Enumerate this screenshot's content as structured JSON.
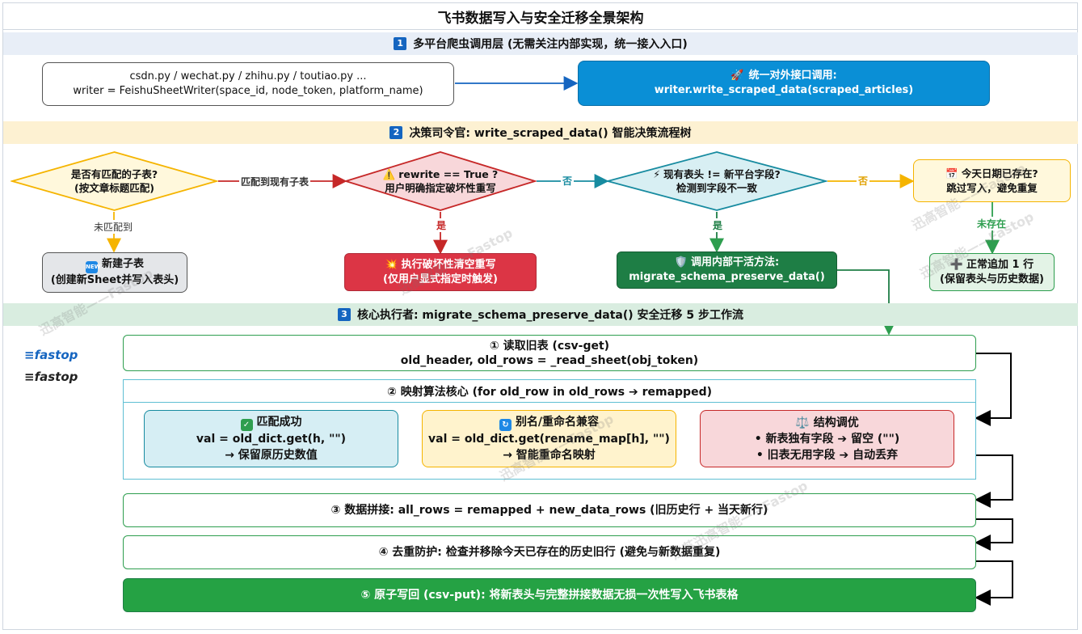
{
  "title": "飞书数据写入与安全迁移全景架构",
  "layer1": {
    "num": "1",
    "title": "多平台爬虫调用层 (无需关注内部实现，统一接入入口)",
    "scripts_line1": "csdn.py / wechat.py / zhihu.py / toutiao.py ...",
    "scripts_line2": "writer = FeishuSheetWriter(space_id, node_token, platform_name)",
    "api_line1": "统一对外接口调用:",
    "api_line2": "writer.write_scraped_data(scraped_articles)",
    "api_icon": "rocket-icon"
  },
  "layer2": {
    "num": "2",
    "title": "决策司令官: write_scraped_data() 智能决策流程树",
    "d1_line1": "是否有匹配的子表?",
    "d1_line2": "(按文章标题匹配)",
    "d1_no": "未匹配到",
    "d1_yes": "匹配到现有子表",
    "d2_line1": "rewrite == True ?",
    "d2_line2": "用户明确指定破坏性重写",
    "d2_icon": "warning-icon",
    "d2_yes": "是",
    "d2_no": "否",
    "d3_line1": "现有表头 != 新平台字段?",
    "d3_line2": "检测到字段不一致",
    "d3_icon": "lightning-icon",
    "d3_yes": "是",
    "d3_no": "否",
    "d4_line1": "今天日期已存在?",
    "d4_line2": "跳过写入，避免重复",
    "d4_icon": "calendar-icon",
    "d4_no": "未存在",
    "r1_line1": "新建子表",
    "r1_line2": "(创建新Sheet并写入表头)",
    "r1_icon": "new-icon",
    "r2_line1": "执行破坏性清空重写",
    "r2_line2": "(仅用户显式指定时触发)",
    "r2_icon": "explosion-icon",
    "r3_line1": "调用内部干活方法:",
    "r3_line2": "migrate_schema_preserve_data()",
    "r3_icon": "shield-icon",
    "r4_line1": "正常追加 1 行",
    "r4_line2": "(保留表头与历史数据)",
    "r4_icon": "plus-icon"
  },
  "layer3": {
    "num": "3",
    "title": "核心执行者: migrate_schema_preserve_data() 安全迁移 5 步工作流",
    "s1_line1": "① 读取旧表 (csv-get)",
    "s1_line2": "old_header, old_rows = _read_sheet(obj_token)",
    "s2_title": "② 映射算法核心 (for old_row in old_rows ➔ remapped)",
    "c1_title": "匹配成功",
    "c1_icon": "check-icon",
    "c1_line1": "val = old_dict.get(h, \"\")",
    "c1_line2": "→ 保留原历史数值",
    "c2_title": "别名/重命名兼容",
    "c2_icon": "refresh-icon",
    "c2_line1": "val = old_dict.get(rename_map[h], \"\")",
    "c2_line2": "→ 智能重命名映射",
    "c3_title": "结构调优",
    "c3_icon": "scales-icon",
    "c3_line1": "• 新表独有字段 ➔ 留空 (\"\")",
    "c3_line2": "• 旧表无用字段 ➔ 自动丢弃",
    "s3": "③ 数据拼接: all_rows = remapped + new_data_rows (旧历史行 + 当天新行)",
    "s4": "④ 去重防护: 检查并移除今天已存在的历史旧行 (避免与新数据重复)",
    "s5": "⑤ 原子写回 (csv-put): 将新表头与完整拼接数据无损一次性写入飞书表格"
  },
  "logos": [
    "fastop",
    "fastop"
  ],
  "watermarks": [
    "迅高智能——Fastop",
    "迅高智能——Fastop",
    "迅高智能——Fastop",
    "迅高智能——Fastop",
    "江苏迅高智能——Fastop",
    "迅高智能——Fastop"
  ],
  "colors": {
    "blue_band": "#e8eef7",
    "yellow_band": "#fdf1d2",
    "green_band": "#d9ede0",
    "api_blue": "#0a8fd6",
    "red": "#dc3545",
    "green": "#1e7e45",
    "step5_green": "#25a244"
  }
}
